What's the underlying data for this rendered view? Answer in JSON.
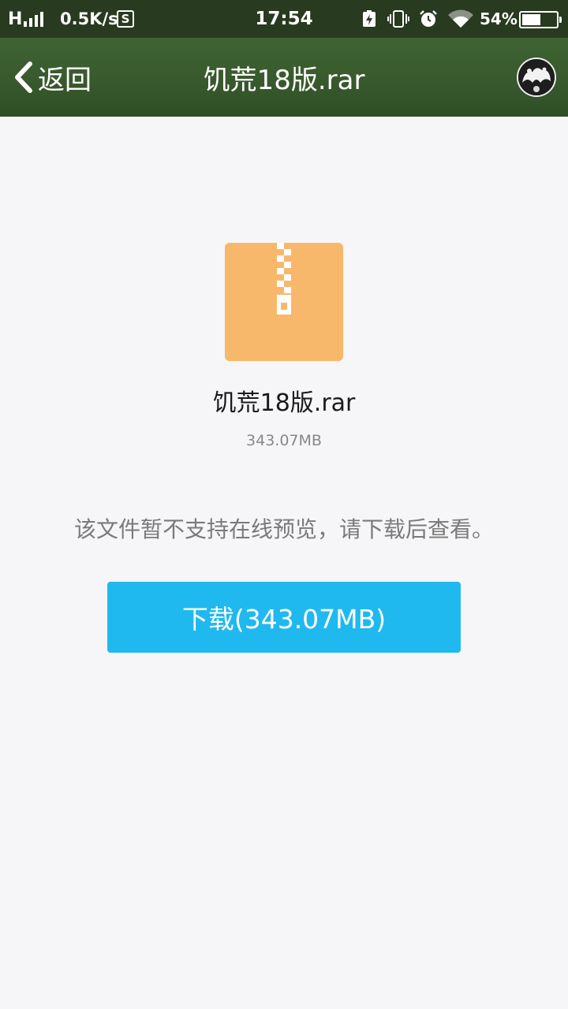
{
  "status_bar": {
    "network_letter": "H",
    "speed": "0.5K/s",
    "s_badge": "S",
    "time": "17:54",
    "battery_percent": "54%",
    "battery_level": 0.54,
    "icons": [
      "signal-icon",
      "sync-icon",
      "charging-icon",
      "vibrate-icon",
      "alarm-icon",
      "wifi-icon",
      "battery-icon"
    ]
  },
  "header": {
    "back_label": "返回",
    "title": "饥荒18版.rar",
    "back_icon": "chevron-left-icon",
    "avatar_icon": "avatar-icon"
  },
  "file": {
    "icon": "zip-file-icon",
    "icon_color": "#f8b86b",
    "name": "饥荒18版.rar",
    "size": "343.07MB"
  },
  "message": "该文件暂不支持在线预览，请下载后查看。",
  "download_button": {
    "label": "下载(343.07MB)",
    "color": "#1fb9f0"
  },
  "colors": {
    "status_bar_bg": "#283a1f",
    "title_bar_bg": "#38592d",
    "page_bg": "#f6f6f8"
  }
}
